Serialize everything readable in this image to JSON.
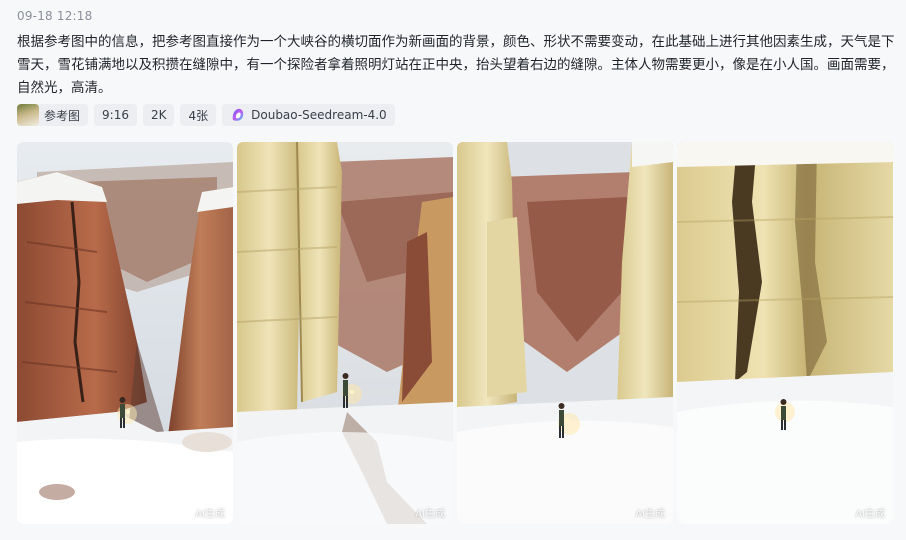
{
  "message": {
    "timestamp": "09-18 12:18",
    "prompt": "根据参考图中的信息，把参考图直接作为一个大峡谷的横切面作为新画面的背景，颜色、形状不需要变动，在此基础上进行其他因素生成，天气是下雪天，雪花铺满地以及积攒在缝隙中，有一个探险者拿着照明灯站在正中央，抬头望着右边的缝隙。主体人物需要更小，像是在小人国。画面需要，自然光，高清。"
  },
  "params": {
    "reference_label": "参考图",
    "ratio": "9:16",
    "resolution": "2K",
    "count": "4张",
    "model": "Doubao-Seedream-4.0",
    "model_icon": "doubao-logo-icon"
  },
  "images": [
    {
      "badge": "AI生成"
    },
    {
      "badge": "AI生成"
    },
    {
      "badge": "AI生成"
    },
    {
      "badge": "AI生成"
    }
  ],
  "colors": {
    "background": "#f7f8fa",
    "chip_bg": "#eceef2",
    "canyon_red": "#a5553a",
    "canyon_cream": "#e8dcaa",
    "snow": "#f4f6f8"
  }
}
